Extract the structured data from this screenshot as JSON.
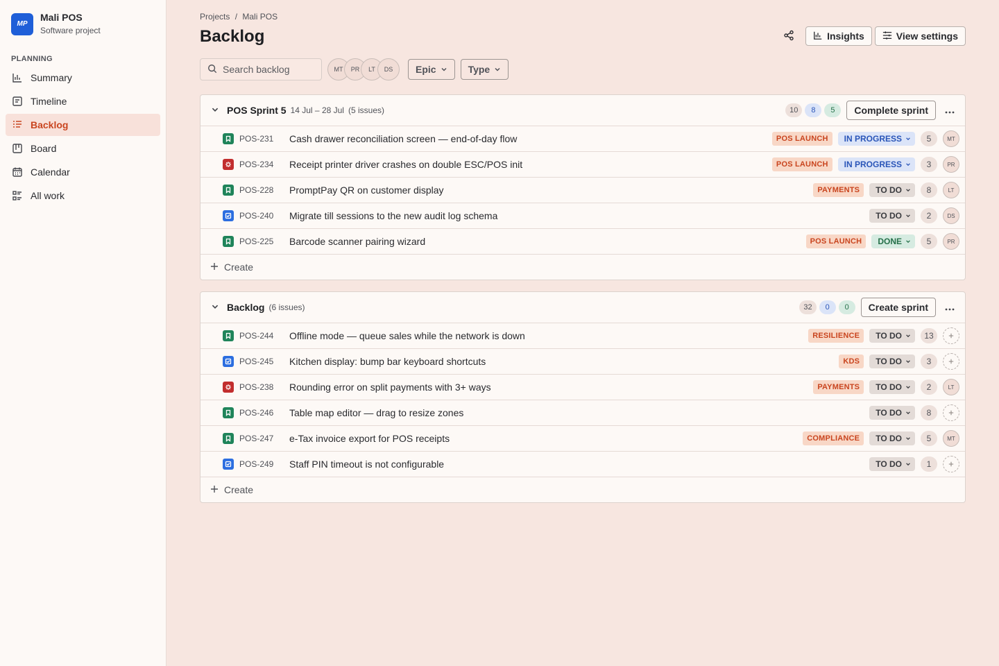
{
  "project": {
    "avatar": "MP",
    "name": "Mali POS",
    "type": "Software project"
  },
  "sidebar": {
    "section_label": "PLANNING",
    "items": [
      {
        "label": "Summary",
        "icon": "chart-icon"
      },
      {
        "label": "Timeline",
        "icon": "timeline-icon"
      },
      {
        "label": "Backlog",
        "icon": "backlog-icon",
        "active": true
      },
      {
        "label": "Board",
        "icon": "board-icon"
      },
      {
        "label": "Calendar",
        "icon": "calendar-icon"
      },
      {
        "label": "All work",
        "icon": "list-icon"
      }
    ]
  },
  "header": {
    "breadcrumb": [
      "Projects",
      "Mali POS"
    ],
    "breadcrumb_sep": "/",
    "title": "Backlog",
    "insights_label": "Insights",
    "view_settings_label": "View settings"
  },
  "toolbar": {
    "search_placeholder": "Search backlog",
    "avatars": [
      "MT",
      "PR",
      "LT",
      "DS"
    ],
    "epic_filter": "Epic",
    "type_filter": "Type"
  },
  "sprint": {
    "title": "POS Sprint 5",
    "dates": "14 Jul – 28 Jul",
    "issue_count": "(5 issues)",
    "counts": {
      "todo": "10",
      "in_progress": "8",
      "done": "5"
    },
    "action_label": "Complete sprint",
    "issues": [
      {
        "type": "story",
        "key": "POS-231",
        "summary": "Cash drawer reconciliation screen — end-of-day flow",
        "epic": "POS LAUNCH",
        "status": "IN PROGRESS",
        "status_kind": "prog",
        "estimate": "5",
        "assignee": "MT"
      },
      {
        "type": "bug",
        "key": "POS-234",
        "summary": "Receipt printer driver crashes on double ESC/POS init",
        "epic": "POS LAUNCH",
        "status": "IN PROGRESS",
        "status_kind": "prog",
        "estimate": "3",
        "assignee": "PR"
      },
      {
        "type": "story",
        "key": "POS-228",
        "summary": "PromptPay QR on customer display",
        "epic": "PAYMENTS",
        "status": "TO DO",
        "status_kind": "todo",
        "estimate": "8",
        "assignee": "LT"
      },
      {
        "type": "task",
        "key": "POS-240",
        "summary": "Migrate till sessions to the new audit log schema",
        "epic": "",
        "status": "TO DO",
        "status_kind": "todo",
        "estimate": "2",
        "assignee": "DS"
      },
      {
        "type": "story",
        "key": "POS-225",
        "summary": "Barcode scanner pairing wizard",
        "epic": "POS LAUNCH",
        "status": "DONE",
        "status_kind": "done",
        "estimate": "5",
        "assignee": "PR"
      }
    ],
    "create_label": "Create"
  },
  "backlog": {
    "title": "Backlog",
    "issue_count": "(6 issues)",
    "counts": {
      "todo": "32",
      "in_progress": "0",
      "done": "0"
    },
    "action_label": "Create sprint",
    "issues": [
      {
        "type": "story",
        "key": "POS-244",
        "summary": "Offline mode — queue sales while the network is down",
        "epic": "RESILIENCE",
        "status": "TO DO",
        "status_kind": "todo",
        "estimate": "13",
        "assignee": ""
      },
      {
        "type": "task",
        "key": "POS-245",
        "summary": "Kitchen display: bump bar keyboard shortcuts",
        "epic": "KDS",
        "status": "TO DO",
        "status_kind": "todo",
        "estimate": "3",
        "assignee": ""
      },
      {
        "type": "bug",
        "key": "POS-238",
        "summary": "Rounding error on split payments with 3+ ways",
        "epic": "PAYMENTS",
        "status": "TO DO",
        "status_kind": "todo",
        "estimate": "2",
        "assignee": "LT"
      },
      {
        "type": "story",
        "key": "POS-246",
        "summary": "Table map editor — drag to resize zones",
        "epic": "",
        "status": "TO DO",
        "status_kind": "todo",
        "estimate": "8",
        "assignee": ""
      },
      {
        "type": "story",
        "key": "POS-247",
        "summary": "e-Tax invoice export for POS receipts",
        "epic": "COMPLIANCE",
        "status": "TO DO",
        "status_kind": "todo",
        "estimate": "5",
        "assignee": "MT"
      },
      {
        "type": "task",
        "key": "POS-249",
        "summary": "Staff PIN timeout is not configurable",
        "epic": "",
        "status": "TO DO",
        "status_kind": "todo",
        "estimate": "1",
        "assignee": ""
      }
    ],
    "create_label": "Create"
  },
  "colors": {
    "accent": "#c9451f",
    "brand": "#1f5fd8",
    "story": "#1f845a",
    "bug": "#c22e2e",
    "task": "#2c6ee0"
  }
}
